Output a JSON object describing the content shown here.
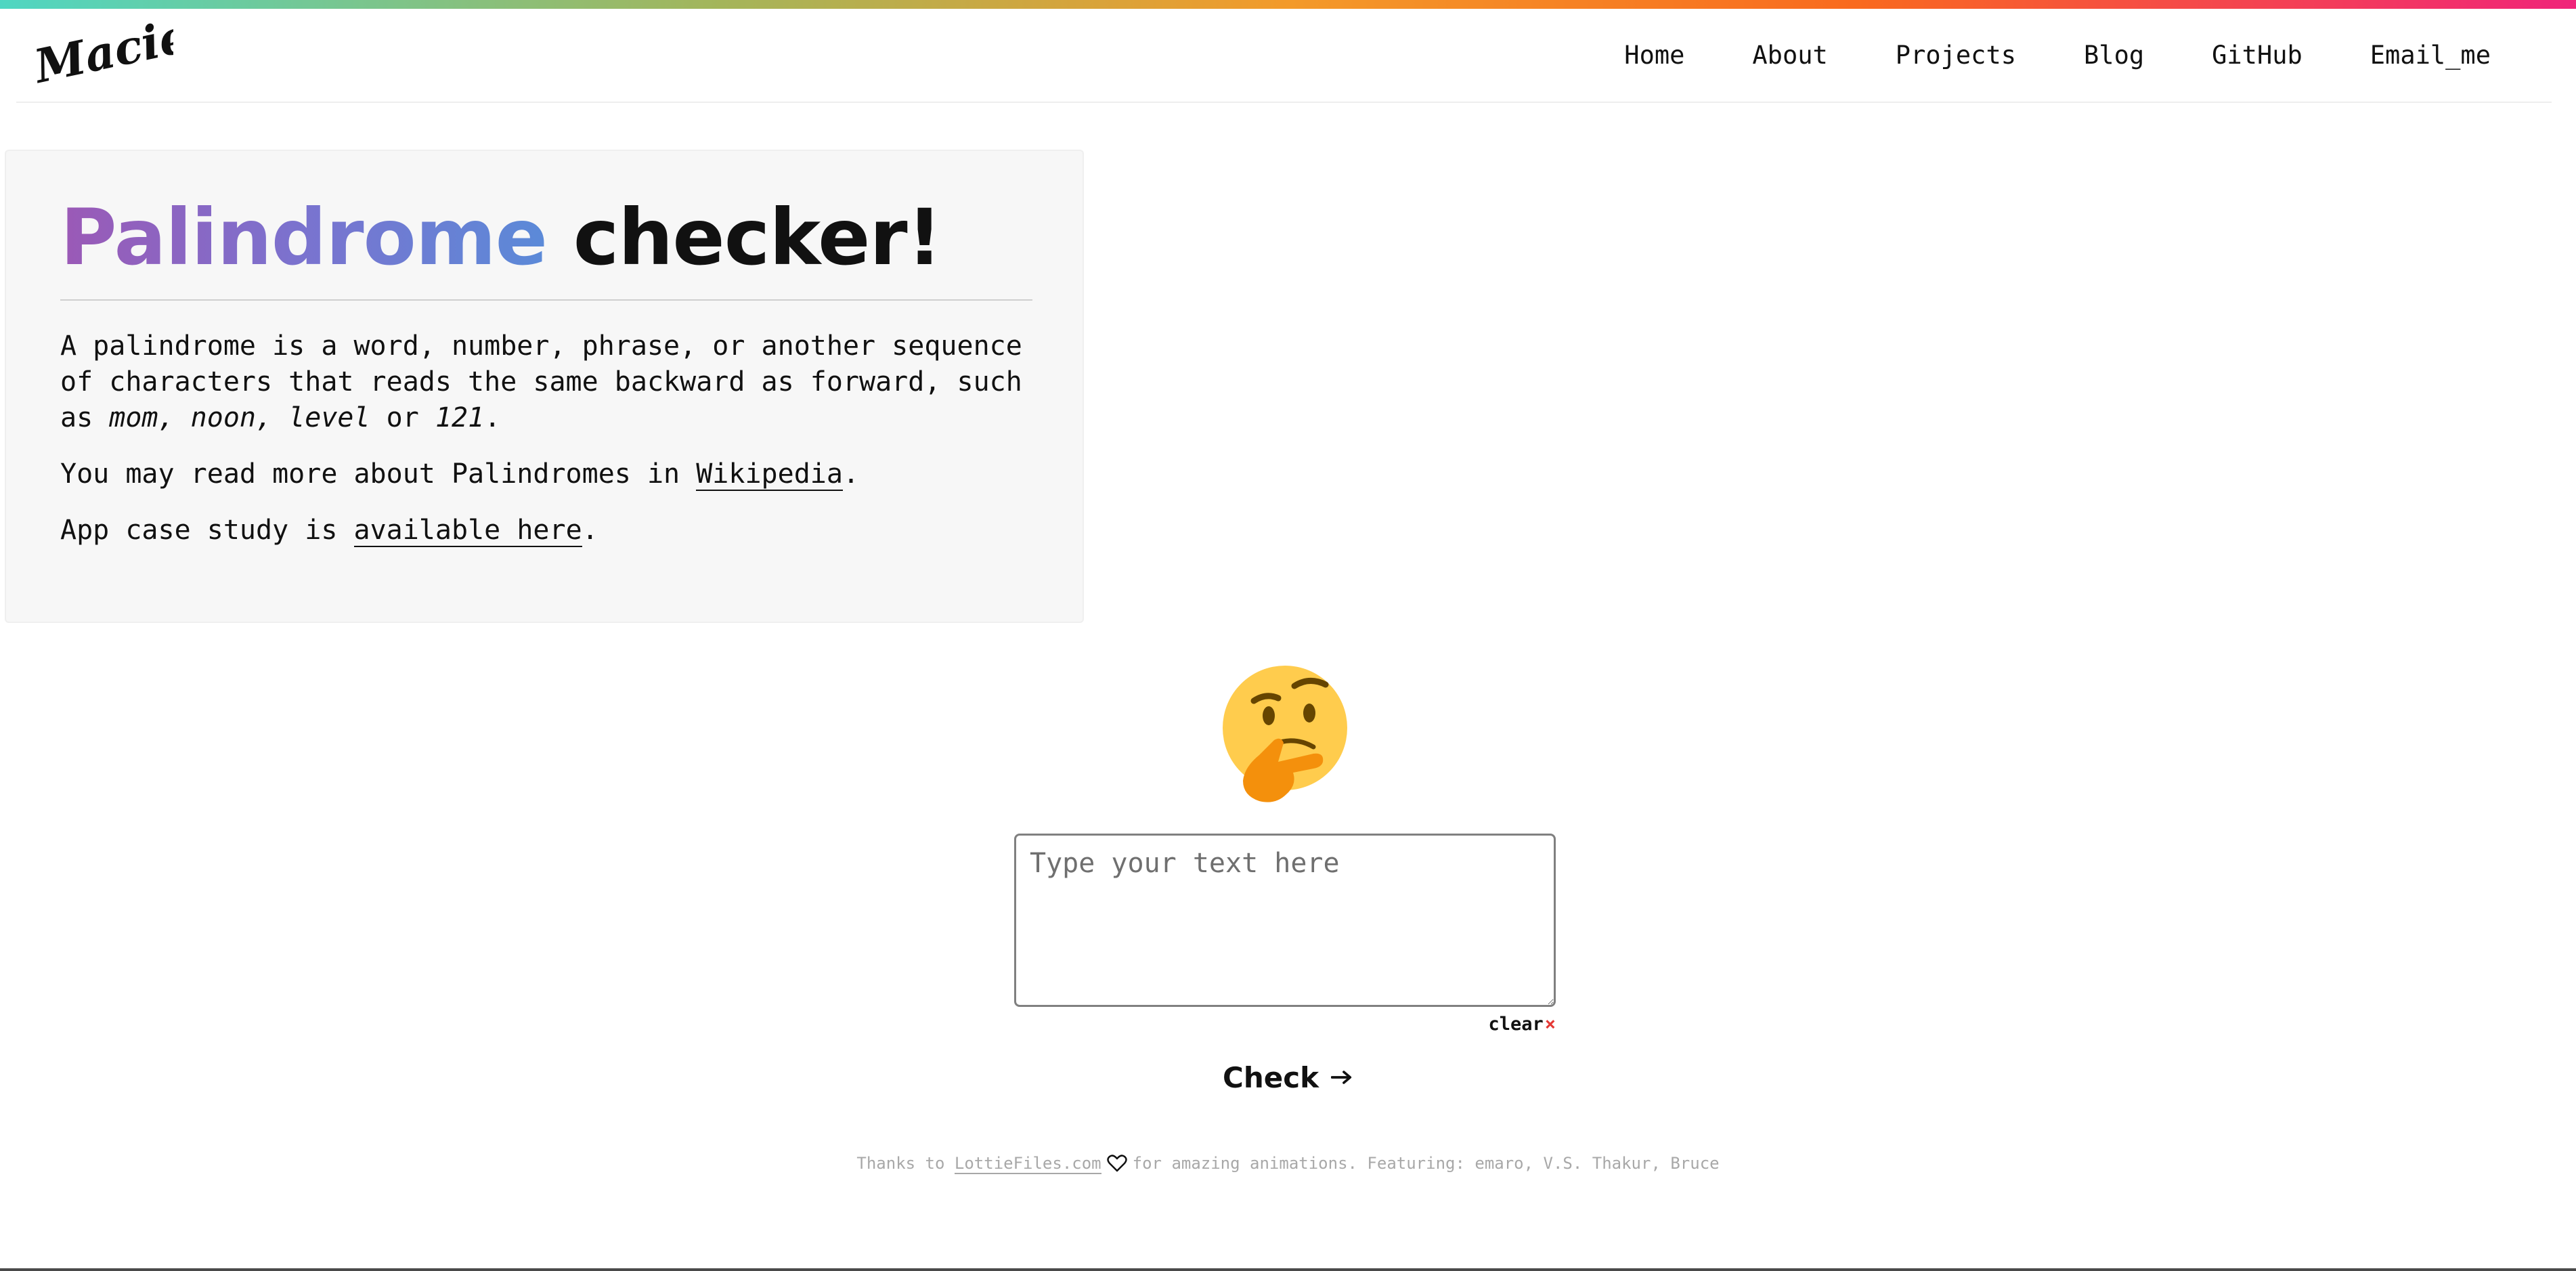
{
  "brand": {
    "logo_text": "Maciej",
    "gradient_colors": [
      "#4fd6c2",
      "#a4b55a",
      "#f39a2a",
      "#f96a1e",
      "#f0247a"
    ]
  },
  "nav": {
    "items": [
      {
        "label": "Home"
      },
      {
        "label": "About"
      },
      {
        "label": "Projects"
      },
      {
        "label": "Blog"
      },
      {
        "label": "GitHub"
      },
      {
        "label": "Email_me"
      }
    ]
  },
  "intro": {
    "title_highlight": "Palindrome",
    "title_rest": "checker!",
    "title_gradient": [
      "#9b59b6",
      "#5b8ad8"
    ],
    "paragraph1_text": "A palindrome is a word, number, phrase, or another sequence of characters that reads the same backward as forward, such as",
    "examples": "mom, noon, level",
    "examples_join": "or",
    "example_number": "121",
    "paragraph2_text": "You may read more about Palindromes in",
    "wikipedia_link": "Wikipedia",
    "paragraph3_text": "App case study is",
    "case_study_link": "available here",
    "period": "."
  },
  "checker": {
    "emoji_icon": "thinking-face-icon",
    "input_placeholder": "Type your text here",
    "input_value": "",
    "clear_label": "clear",
    "clear_symbol": "×",
    "check_label": "Check",
    "check_icon": "arrow-right-icon"
  },
  "footer": {
    "thanks_prefix": "Thanks to",
    "lottie_link": "LottieFiles.com",
    "heart_icon": "heart-icon",
    "thanks_suffix": "for amazing animations. Featuring: emaro, V.S. Thakur, Bruce"
  }
}
